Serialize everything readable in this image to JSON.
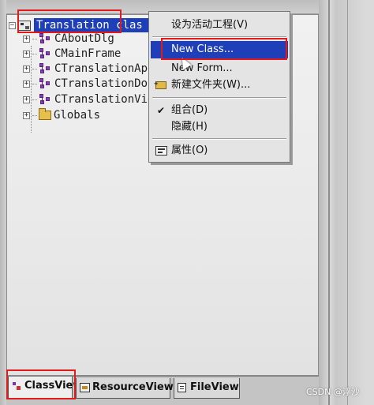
{
  "tree": {
    "root": "Translation clas",
    "items": [
      {
        "label": "CAboutDlg",
        "kind": "class"
      },
      {
        "label": "CMainFrame",
        "kind": "class"
      },
      {
        "label": "CTranslationApp",
        "kind": "class"
      },
      {
        "label": "CTranslationDoc",
        "kind": "class"
      },
      {
        "label": "CTranslationVie",
        "kind": "class"
      },
      {
        "label": "Globals",
        "kind": "folder"
      }
    ]
  },
  "context_menu": {
    "items": [
      {
        "label": "设为活动工程(V)"
      },
      {
        "label": "New Class...",
        "selected": true
      },
      {
        "label": "New Form..."
      },
      {
        "label": "新建文件夹(W)..."
      },
      {
        "label": "组合(D)",
        "checked": true
      },
      {
        "label": "隐藏(H)"
      },
      {
        "label": "属性(O)"
      }
    ]
  },
  "tabs": [
    {
      "label": "ClassView",
      "active": true
    },
    {
      "label": "ResourceView"
    },
    {
      "label": "FileView"
    }
  ],
  "watermark": "CSDN @浮沙",
  "colors": {
    "selection": "#1f3fb8",
    "highlight_box": "#e01b1b"
  }
}
